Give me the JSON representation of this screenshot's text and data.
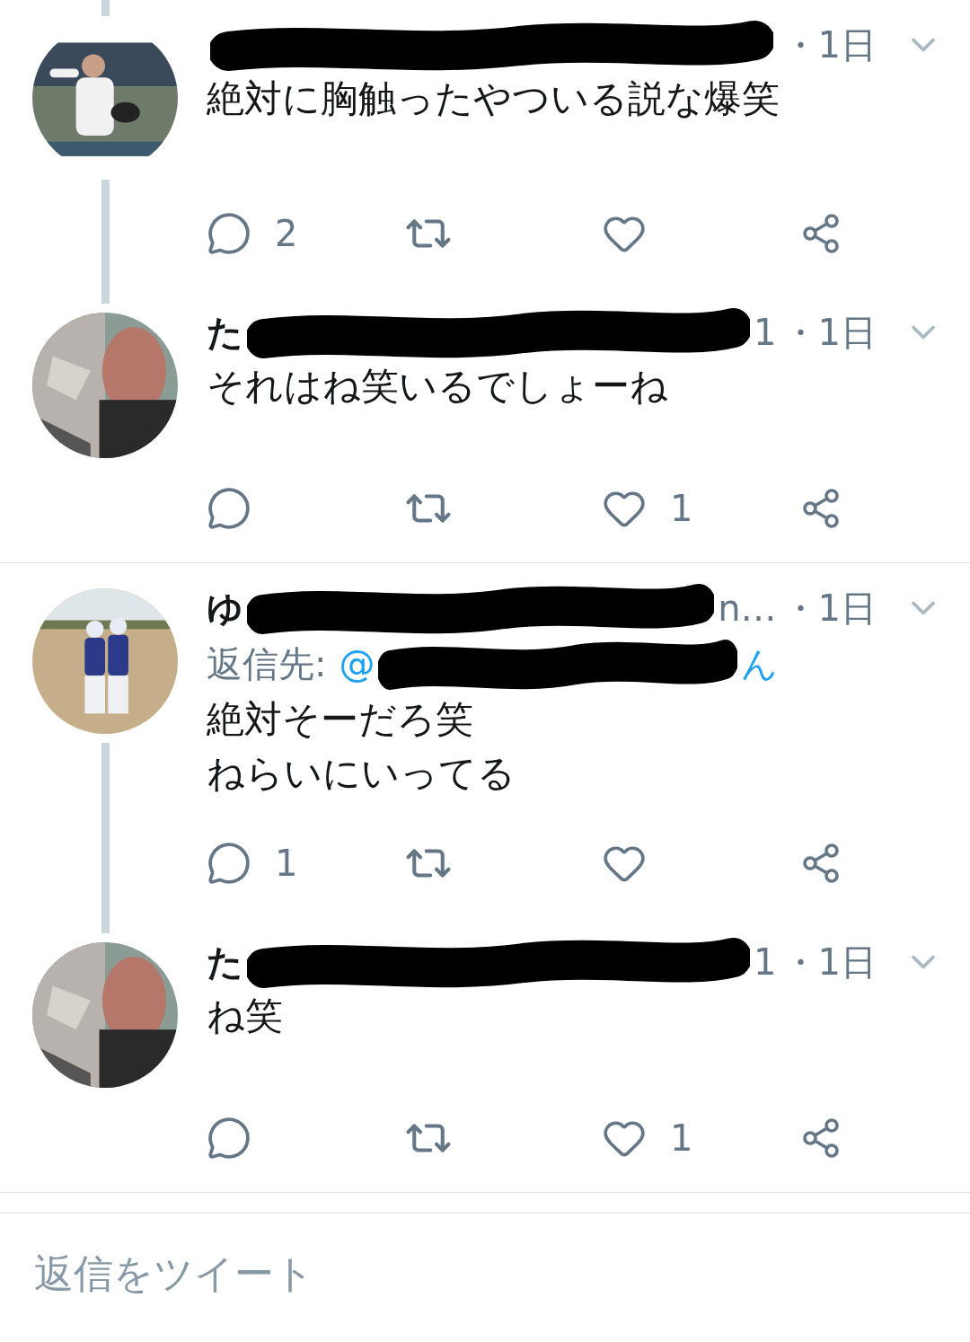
{
  "tweets": [
    {
      "thread_above": true,
      "thread_below": true,
      "avatar": {
        "kind": "picture"
      },
      "header": {
        "redacted": true,
        "time": "・1日"
      },
      "body": [
        "絶対に胸触ったやついる説な爆笑"
      ],
      "actions": {
        "replies": "2"
      }
    },
    {
      "thread_above": true,
      "thread_below": false,
      "avatar": {
        "kind": "picture"
      },
      "header": {
        "name": "た",
        "redacted": true,
        "handle_tail": "1",
        "time": "・1日"
      },
      "body": [
        "それはね笑いるでしょーね"
      ],
      "actions": {
        "likes": "1"
      }
    },
    {
      "thread_above": false,
      "thread_below": true,
      "avatar": {
        "kind": "picture"
      },
      "header": {
        "name": "ゆ",
        "redacted": true,
        "handle_tail": "n…",
        "time": "・1日"
      },
      "reply_to": {
        "label": "返信先:",
        "handle_start": "@",
        "handle_end": "ん",
        "redacted": true
      },
      "body": [
        "絶対そーだろ笑",
        "ねらいにいってる"
      ],
      "actions": {
        "replies": "1"
      }
    },
    {
      "thread_above": true,
      "thread_below": false,
      "avatar": {
        "kind": "picture"
      },
      "header": {
        "name": "た",
        "redacted": true,
        "handle_tail": "1",
        "time": "・1日"
      },
      "body": [
        "ね笑"
      ],
      "actions": {
        "likes": "1"
      }
    }
  ],
  "compose": {
    "placeholder": "返信をツイート"
  }
}
